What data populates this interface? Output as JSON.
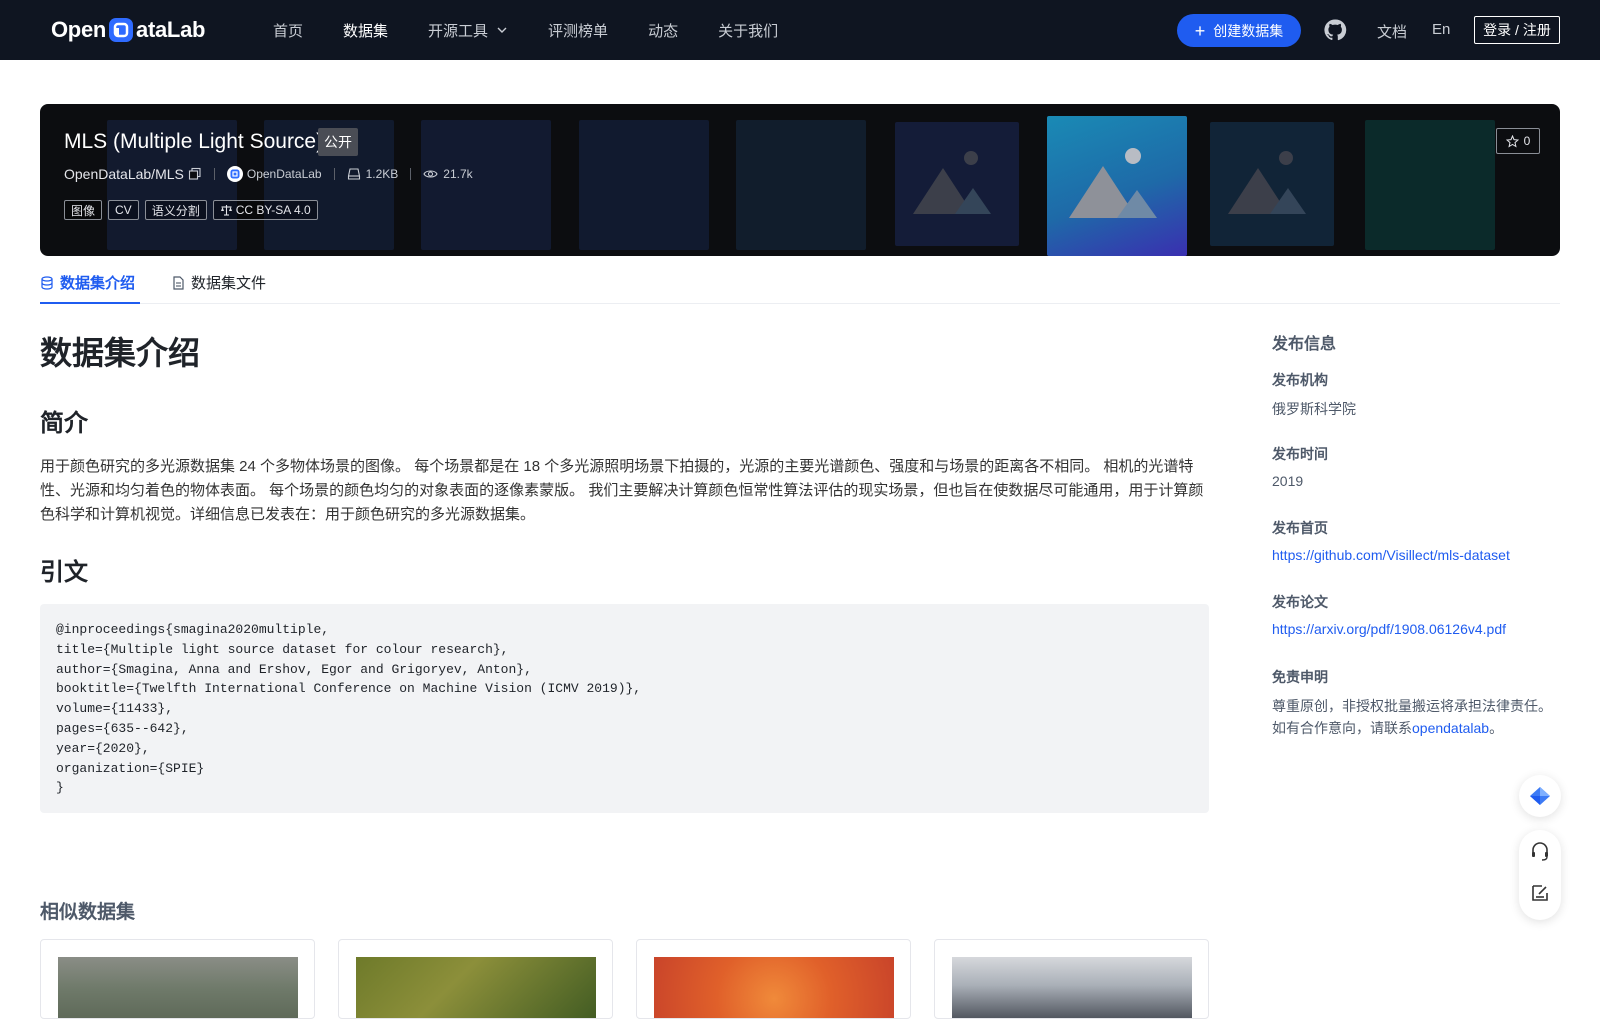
{
  "nav": {
    "logo_text_left": "Open",
    "logo_text_right": "ataLab",
    "links": [
      "首页",
      "数据集",
      "开源工具",
      "评测榜单",
      "动态",
      "关于我们"
    ],
    "active_index": 1,
    "create_label": "创建数据集",
    "docs_label": "文档",
    "lang_label": "En",
    "login_label": "登录 / 注册"
  },
  "dataset": {
    "title": "MLS (Multiple Light Source)",
    "visibility": "公开",
    "repo": "OpenDataLab/MLS",
    "owner": "OpenDataLab",
    "size": "1.2KB",
    "views": "21.7k",
    "tags": [
      "图像",
      "CV",
      "语义分割",
      "CC BY-SA 4.0"
    ],
    "stars": "0"
  },
  "tabs": [
    "数据集介绍",
    "数据集文件"
  ],
  "main": {
    "heading": "数据集介绍",
    "intro_heading": "简介",
    "intro_text": "用于颜色研究的多光源数据集 24 个多物体场景的图像。 每个场景都是在 18 个多光源照明场景下拍摄的，光源的主要光谱颜色、强度和与场景的距离各不相同。 相机的光谱特性、光源和均匀着色的物体表面。 每个场景的颜色均匀的对象表面的逐像素蒙版。 我们主要解决计算颜色恒常性算法评估的现实场景，但也旨在使数据尽可能通用，用于计算颜色科学和计算机视觉。详细信息已发表在：用于颜色研究的多光源数据集。",
    "citation_heading": "引文",
    "citation": "@inproceedings{smagina2020multiple,\ntitle={Multiple light source dataset for colour research},\nauthor={Smagina, Anna and Ershov, Egor and Grigoryev, Anton},\nbooktitle={Twelfth International Conference on Machine Vision (ICMV 2019)},\nvolume={11433},\npages={635--642},\nyear={2020},\norganization={SPIE}\n}",
    "similar_heading": "相似数据集"
  },
  "sidebar": {
    "title": "发布信息",
    "org_label": "发布机构",
    "org_value": "俄罗斯科学院",
    "time_label": "发布时间",
    "time_value": "2019",
    "home_label": "发布首页",
    "home_url": "https://github.com/Visillect/mls-dataset",
    "paper_label": "发布论文",
    "paper_url": "https://arxiv.org/pdf/1908.06126v4.pdf",
    "disclaimer_label": "免责申明",
    "disclaimer_line1": "尊重原创，非授权批量搬运将承担法律责任。",
    "disclaimer_line2_prefix": "如有合作意向，请联系",
    "disclaimer_link": "opendatalab",
    "disclaimer_suffix": "。"
  },
  "colors": {
    "nav_bg": "#0f1521",
    "accent": "#1f5cf0",
    "hero_bg": "#0c0d10"
  }
}
